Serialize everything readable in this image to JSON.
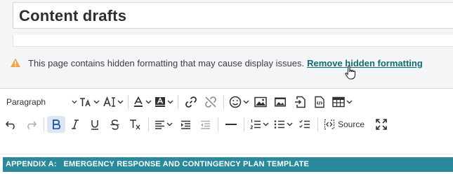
{
  "page": {
    "title": "Content drafts"
  },
  "notice": {
    "message": "This page contains hidden formatting that may cause display issues.",
    "link_label": "Remove hidden formatting"
  },
  "toolbar": {
    "paragraph_label": "Paragraph",
    "source_label": "Source",
    "row1_icons": [
      "font-size-icon",
      "font-family-icon",
      "font-color-icon",
      "highlight-icon",
      "link-icon",
      "unlink-icon",
      "emoji-icon",
      "image-icon",
      "media-icon",
      "insert-file-icon",
      "embed-code-icon",
      "table-icon"
    ],
    "row2_icons": [
      "undo-icon",
      "redo-icon",
      "bold-icon",
      "italic-icon",
      "underline-icon",
      "strikethrough-icon",
      "clear-format-icon",
      "align-icon",
      "indent-icon",
      "outdent-icon",
      "horizontal-rule-icon",
      "numbered-list-icon",
      "bullet-list-icon",
      "checklist-icon",
      "source-icon",
      "fullscreen-icon"
    ]
  },
  "document": {
    "heading": "APPENDIX A:   EMERGENCY RESPONSE AND CONTINGENCY PLAN TEMPLATE"
  },
  "colors": {
    "accent": "#2a8a9b",
    "link": "#0f6e74",
    "warning": "#f2a541"
  }
}
